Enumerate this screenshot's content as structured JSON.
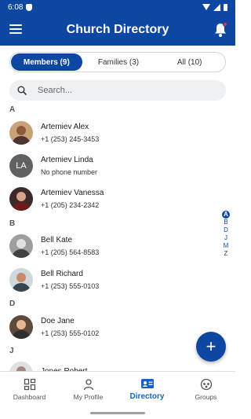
{
  "status": {
    "time": "6:08"
  },
  "app": {
    "title": "Church Directory"
  },
  "tabs": [
    {
      "label": "Members (9)",
      "active": true
    },
    {
      "label": "Families (3)",
      "active": false
    },
    {
      "label": "All (10)",
      "active": false
    }
  ],
  "search": {
    "placeholder": "Search..."
  },
  "sections": [
    {
      "letter": "A"
    },
    {
      "letter": "B"
    },
    {
      "letter": "D"
    },
    {
      "letter": "J"
    }
  ],
  "members": [
    {
      "name": "Artemiev Alex",
      "phone": "+1 (253) 245-3453",
      "avatar": "photo"
    },
    {
      "name": "Artemiev Linda",
      "phone": "No phone number",
      "avatar": "initials",
      "initials": "LA"
    },
    {
      "name": "Artemiev Vanessa",
      "phone": "+1 (205) 234-2342",
      "avatar": "photo"
    },
    {
      "name": "Bell Kate",
      "phone": "+1 (205) 564-8583",
      "avatar": "photo"
    },
    {
      "name": "Bell Richard",
      "phone": "+1 (253) 555-0103",
      "avatar": "photo"
    },
    {
      "name": "Doe Jane",
      "phone": "+1 (253) 555-0102",
      "avatar": "photo"
    },
    {
      "name": "Jones Robert",
      "phone": "",
      "avatar": "photo"
    }
  ],
  "alphabet": [
    "A",
    "B",
    "D",
    "J",
    "M",
    "Z"
  ],
  "alphabet_active": "A",
  "fab": {
    "label": "+"
  },
  "nav": [
    {
      "label": "Dashboard",
      "icon": "dashboard-icon",
      "active": false
    },
    {
      "label": "My Profile",
      "icon": "person-icon",
      "active": false
    },
    {
      "label": "Directory",
      "icon": "contact-card-icon",
      "active": true
    },
    {
      "label": "Groups",
      "icon": "groups-icon",
      "active": false
    }
  ],
  "colors": {
    "primary": "#0d47a1",
    "accent": "#1565c0",
    "badge": "#e53935"
  }
}
